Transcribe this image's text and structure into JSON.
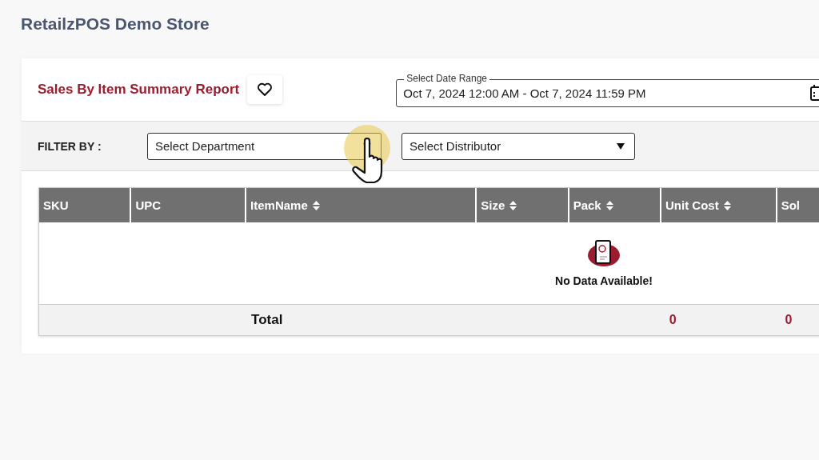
{
  "store_title": "RetailzPOS Demo Store",
  "report": {
    "title": "Sales By Item Summary Report"
  },
  "date_range": {
    "label": "Select Date Range",
    "value": "Oct 7, 2024 12:00 AM - Oct 7, 2024 11:59 PM"
  },
  "filter": {
    "label": "FILTER BY :",
    "selects": [
      {
        "placeholder": "Select Department"
      },
      {
        "placeholder": "Select Distributor"
      }
    ]
  },
  "table": {
    "columns": [
      {
        "label": "SKU",
        "sortable": false
      },
      {
        "label": "UPC",
        "sortable": false
      },
      {
        "label": "ItemName",
        "sortable": true
      },
      {
        "label": "Size",
        "sortable": true
      },
      {
        "label": "Pack",
        "sortable": true
      },
      {
        "label": "Unit Cost",
        "sortable": true
      },
      {
        "label": "Sol",
        "sortable": false
      }
    ],
    "empty_message": "No Data Available!",
    "totals": {
      "label": "Total",
      "values": [
        "0",
        "0"
      ]
    }
  }
}
